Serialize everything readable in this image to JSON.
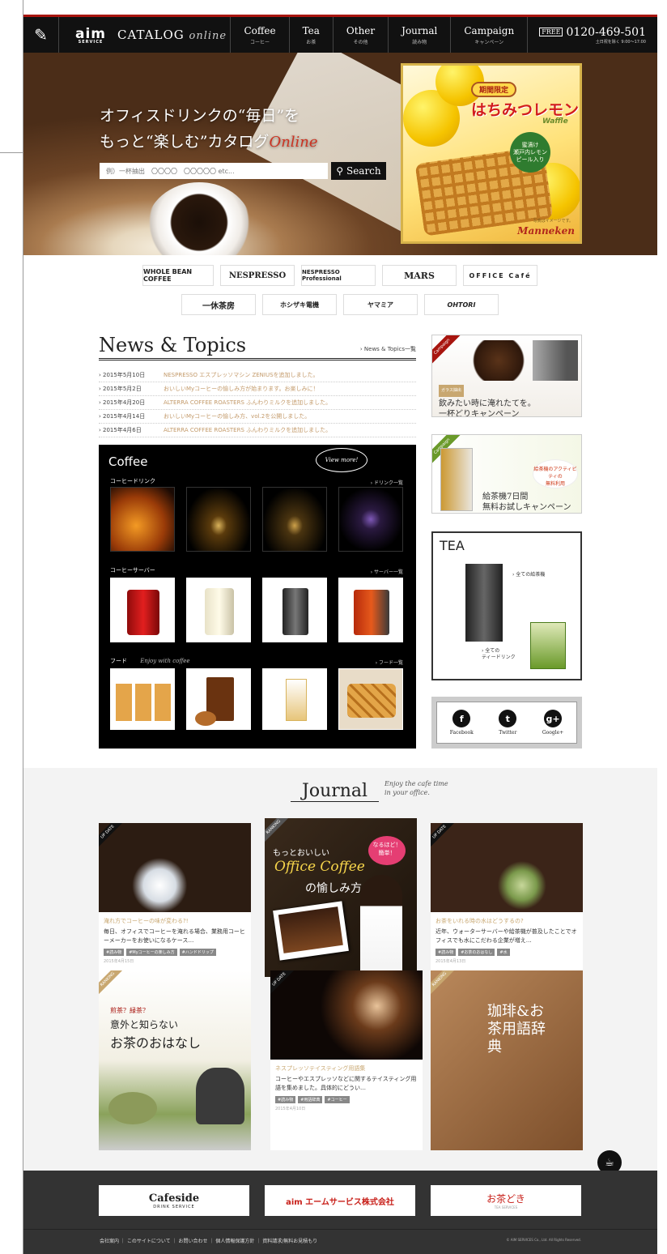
{
  "header": {
    "brand_aim": "aim",
    "brand_aim_sub": "SERVICE",
    "brand_catalog": "CATALOG",
    "brand_online": "online",
    "nav": [
      {
        "en": "Coffee",
        "jp": "コーヒー"
      },
      {
        "en": "Tea",
        "jp": "お茶"
      },
      {
        "en": "Other",
        "jp": "その他"
      },
      {
        "en": "Journal",
        "jp": "読み物"
      },
      {
        "en": "Campaign",
        "jp": "キャンペーン"
      }
    ],
    "tel": "0120-469-501",
    "tel_badge": "FREE",
    "hours": "土日祝を除く 9:00〜17:00"
  },
  "hero": {
    "line1": "オフィスドリンクの“毎日”を",
    "line2": "もっと“楽しむ”カタログ",
    "online": "Online",
    "search_placeholder": "例）一杯抽出　〇〇〇〇　〇〇〇〇〇 etc...",
    "search_button": "Search",
    "promo": {
      "badge": "期間限定",
      "title": "はちみつレモン",
      "sub": "Waffle",
      "circle": "蜜漬け\n瀬戸内レモン\nピール入り",
      "note": "写真はイメージです。",
      "brand": "Manneken"
    }
  },
  "partners": {
    "row1": [
      "WHOLE BEAN COFFEE",
      "NESPRESSO",
      "NESPRESSO Professional",
      "MARS",
      "OFFICE Café"
    ],
    "row2": [
      "一休茶房",
      "ホシザキ電機",
      "ヤマミア",
      "OHTORI"
    ]
  },
  "news": {
    "title": "News & Topics",
    "more": "› News & Topics一覧",
    "items": [
      {
        "date": "› 2015年5月10日",
        "text": "NESPRESSO エスプレッソマシン ZENIUSを追加しました。"
      },
      {
        "date": "› 2015年5月2日",
        "text": "おいしいMyコーヒーの愉しみ方が始まります。お楽しみに！"
      },
      {
        "date": "› 2015年4月20日",
        "text": "ALTERRA COFFEE ROASTERS ふんわりミルクを追加しました。"
      },
      {
        "date": "› 2015年4月14日",
        "text": "おいしいMyコーヒーの愉しみ方、vol.2を公開しました。"
      },
      {
        "date": "› 2015年4月6日",
        "text": "ALTERRA COFFEE ROASTERS ふんわりミルクを追加しました。"
      }
    ]
  },
  "coffee": {
    "title": "Coffee",
    "stamp": "View more!",
    "drink_label": "コーヒードリンク",
    "drink_more": "› ドリンク一覧",
    "server_label": "コーヒーサーバー",
    "server_more": "› サーバー一覧",
    "food_label": "フード",
    "food_note": "Enjoy with coffee",
    "food_more": "› フード一覧"
  },
  "side": {
    "b1_tag": "ガラス抽出",
    "b1_copy": "飲みたい時に淹れたてを。\n一杯どりキャンペーン",
    "b1_ribbon": "Campaign",
    "b2_ribbon": "Campaign",
    "b2_free": "給茶機のアクティビティの\n無料利用",
    "b2_copy": "給茶機7日間\n無料お試しキャンペーン",
    "b3_title": "TEA",
    "b3_link1": "› 全ての給茶機",
    "b3_link2": "› 全ての\nティードリンク",
    "social": [
      {
        "icon": "f",
        "label": "Facebook"
      },
      {
        "icon": "t",
        "label": "Twitter"
      },
      {
        "icon": "g+",
        "label": "Google+"
      }
    ]
  },
  "journal": {
    "title": "Journal",
    "tagline": "Enjoy the cafe time\nin your office.",
    "cards": [
      {
        "ribbon": "UP DATE",
        "title": "淹れ方でコーヒーの味が変わる?!",
        "desc": "毎日、オフィスでコーヒーを淹れる場合、業務用コーヒーメーカーをお使いになるケース…",
        "tags": [
          "#読み物",
          "#Myコーヒーの楽しみ方",
          "#ハンドドリップ"
        ],
        "date": "2015年4月15日"
      },
      {
        "ribbon": "RANKING",
        "title": "もっとおいしい",
        "script": "Office Coffee",
        "tail": "の愉しみ方",
        "bubble": "なるほど！簡単！"
      },
      {
        "ribbon": "UP DATE",
        "title": "お茶をいれる時の水はどうするの?",
        "desc": "近年、ウォーターサーバーや給茶機が普及したことでオフィスでも水にこだわる企業が増え…",
        "tags": [
          "#読み物",
          "#お茶のおはなし",
          "#水"
        ],
        "date": "2015年4月13日"
      },
      {
        "ribbon": "RANKING",
        "kicker": "煎茶？緑茶？",
        "title": "意外と知らない",
        "big": "お茶のおはなし"
      },
      {
        "ribbon": "UP DATE",
        "title": "ネスプレッソテイスティング用語集",
        "desc": "コーヒーやエスプレッソなどに関するテイスティング用語を集めました。具体的にどうい…",
        "tags": [
          "#読み物",
          "#用語辞典",
          "#コーヒー"
        ],
        "date": "2015年4月10日"
      },
      {
        "ribbon": "RANKING",
        "big": "珈琲&お茶用語辞典"
      }
    ]
  },
  "footer": {
    "logos": [
      "Cafeside",
      "aim エームサービス株式会社",
      "お茶どき"
    ],
    "cafeside_sub": "DRINK SERVICE",
    "ochadoki_sub": "TEA SERVICES",
    "links": [
      "会社案内",
      "このサイトについて",
      "お問い合わせ",
      "個人情報保護方針",
      "資料請求/無料お見積もり"
    ],
    "copyright": "© AIM SERVICES Co., Ltd. All Rights Reserved."
  },
  "colors": {
    "accent": "#a8150f",
    "header_bg": "#111111",
    "footer_bg": "#333333",
    "news_text": "#c39a6a"
  }
}
